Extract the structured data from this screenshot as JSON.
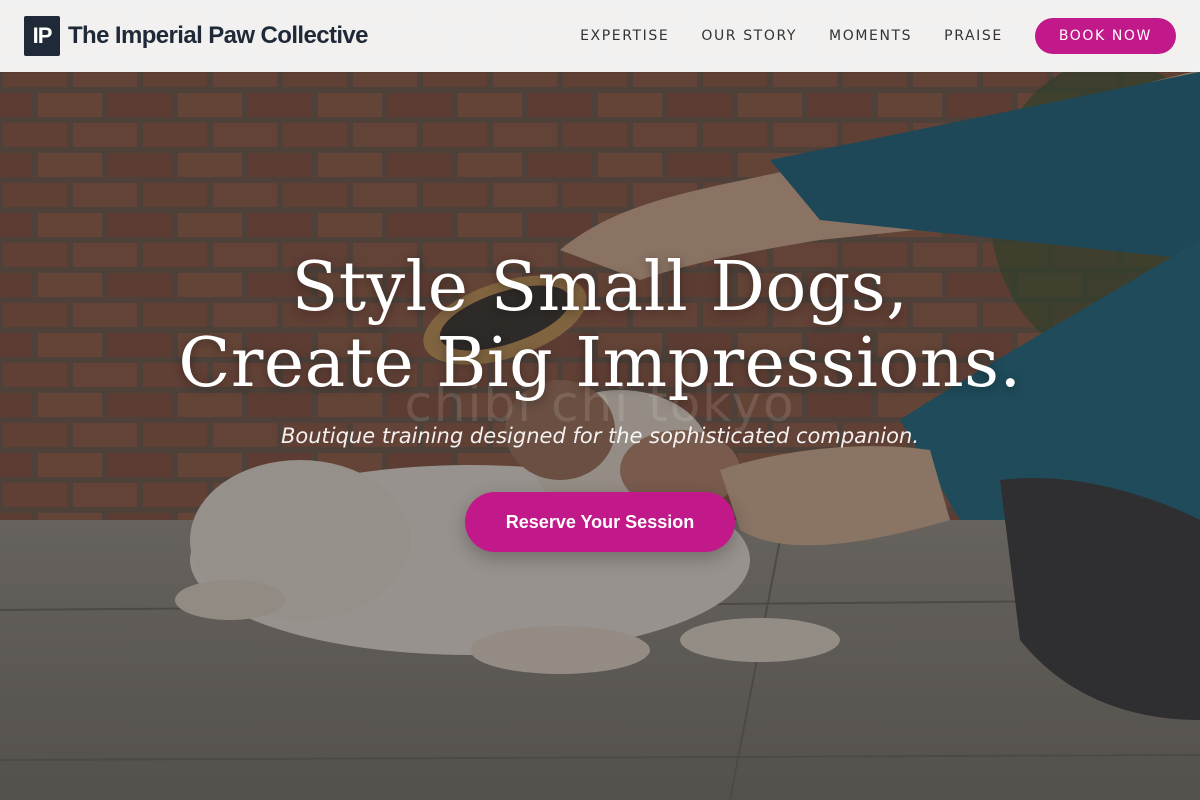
{
  "brand": {
    "mark": "IP",
    "name": "The Imperial Paw Collective"
  },
  "nav": {
    "items": [
      {
        "label": "EXPERTISE"
      },
      {
        "label": "OUR STORY"
      },
      {
        "label": "MOMENTS"
      },
      {
        "label": "PRAISE"
      }
    ],
    "cta_label": "BOOK NOW"
  },
  "hero": {
    "title_line1": "Style Small Dogs,",
    "title_line2": "Create Big Impressions.",
    "watermark": "chibi   chi   tokyo",
    "subtitle": "Boutique training designed for the sophisticated companion.",
    "cta_label": "Reserve Your Session",
    "image": "background photo of a person brushing a small white and brown dog lying on a tiled floor in front of a brick wall"
  },
  "colors": {
    "accent": "#c2198a",
    "header_bg": "#f7f7f7",
    "brand_dark": "#1f2937"
  }
}
